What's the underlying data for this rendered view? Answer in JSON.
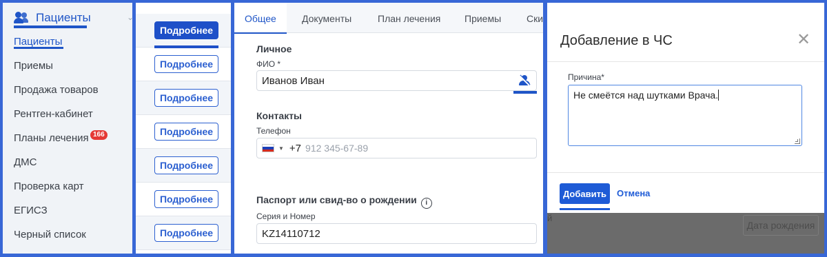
{
  "sidebar": {
    "header": {
      "title": "Пациенты",
      "icon": "users-icon",
      "chevron": "chevron-down-icon"
    },
    "items": [
      {
        "label": "Пациенты",
        "active": true
      },
      {
        "label": "Приемы"
      },
      {
        "label": "Продажа товаров"
      },
      {
        "label": "Рентген-кабинет"
      },
      {
        "label": "Планы лечения",
        "badge": "166"
      },
      {
        "label": "ДМС"
      },
      {
        "label": "Проверка карт"
      },
      {
        "label": "ЕГИСЗ"
      },
      {
        "label": "Черный список"
      }
    ]
  },
  "list": {
    "button_label": "Подробнее",
    "rows": 7
  },
  "patient_form": {
    "tabs": [
      "Общее",
      "Документы",
      "План лечения",
      "Приемы",
      "Ски"
    ],
    "personal": {
      "section_title": "Личное",
      "fio_label": "ФИО *",
      "fio_value": "Иванов Иван",
      "blacklist_icon": "person-off-icon"
    },
    "contacts": {
      "section_title": "Контакты",
      "phone_label": "Телефон",
      "phone_code": "+7",
      "phone_placeholder": "912 345-67-89",
      "country_flag": "ru-flag-icon"
    },
    "passport": {
      "section_title": "Паспорт или свид-во о рождении",
      "info_icon": "info-icon",
      "series_label": "Серия и Номер",
      "series_value": "KZ14110712"
    }
  },
  "modal": {
    "title": "Добавление в ЧС",
    "close_icon": "close-icon",
    "reason_label": "Причина*",
    "reason_value": "Не смеётся над шутками Врача.",
    "add_button": "Добавить",
    "cancel_button": "Отмена",
    "background": {
      "text": "й",
      "date_field": "Дата рождения"
    }
  },
  "colors": {
    "accent": "#1f55c7",
    "frame": "#3867d6",
    "badge": "#e53935",
    "overlay": "#6b6b6b"
  }
}
